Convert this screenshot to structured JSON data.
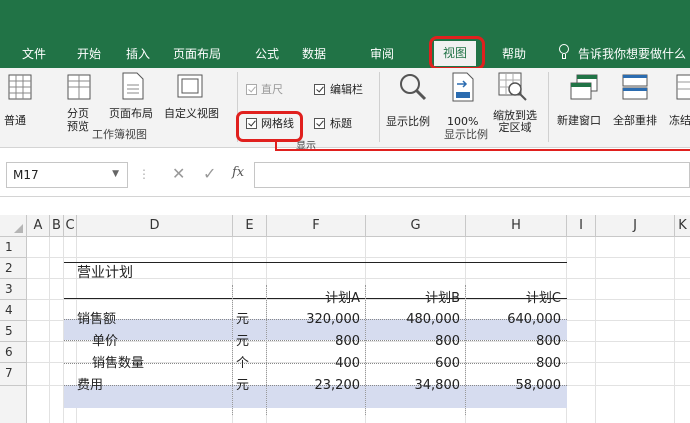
{
  "ribbon_tabs": [
    "文件",
    "开始",
    "插入",
    "页面布局",
    "公式",
    "数据",
    "审阅",
    "视图",
    "帮助",
    "告诉我你想要做什么"
  ],
  "active_tab": "视图",
  "workbook_views": {
    "buttons": [
      "普通",
      "分页预览",
      "页面布局",
      "自定义视图"
    ],
    "group_label": "工作簿视图"
  },
  "show": {
    "ruler": {
      "label": "直尺",
      "checked": true,
      "enabled": false
    },
    "formula_bar": {
      "label": "编辑栏",
      "checked": true,
      "enabled": true
    },
    "gridlines": {
      "label": "网格线",
      "checked": true,
      "enabled": true
    },
    "headings": {
      "label": "标题",
      "checked": true,
      "enabled": true
    },
    "group_label": "显示"
  },
  "zoom": {
    "buttons": [
      "显示比例",
      "100%",
      "缩放到选定区域"
    ],
    "group_label": "显示比例"
  },
  "window": {
    "buttons": [
      "新建窗口",
      "全部重排",
      "冻结窗格"
    ]
  },
  "formula_bar": {
    "name_box": "M17",
    "formula": ""
  },
  "columns": [
    "A",
    "B",
    "C",
    "D",
    "E",
    "F",
    "G",
    "H",
    "I",
    "J",
    "K"
  ],
  "rows": [
    "1",
    "2",
    "3",
    "4",
    "5",
    "6",
    "7"
  ],
  "sheet": {
    "title": "营业计划",
    "headers": [
      "计划A",
      "计划B",
      "计划C"
    ],
    "rows": [
      {
        "label": "销售额",
        "unit": "元",
        "values": [
          "320,000",
          "480,000",
          "640,000"
        ],
        "highlight": true
      },
      {
        "label": "单价",
        "unit": "元",
        "values": [
          "800",
          "800",
          "800"
        ],
        "highlight": false
      },
      {
        "label": "销售数量",
        "unit": "个",
        "values": [
          "400",
          "600",
          "800"
        ],
        "highlight": false
      },
      {
        "label": "费用",
        "unit": "元",
        "values": [
          "23,200",
          "34,800",
          "58,000"
        ],
        "highlight": true
      }
    ]
  },
  "colors": {
    "ribbon_green": "#217346",
    "highlight_band": "#d6dcef",
    "callout_red": "#e0201e"
  }
}
